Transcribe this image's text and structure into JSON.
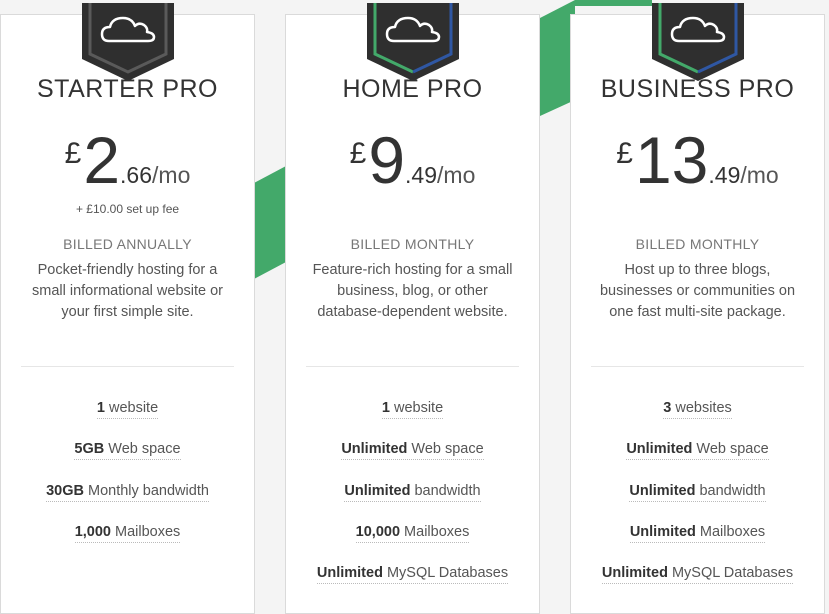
{
  "colors": {
    "accent_green": "#43a96a",
    "badge_dark": "#2f2f2f",
    "badge_blue": "#2f57a3",
    "text_dark": "#333333"
  },
  "plans": [
    {
      "name": "STARTER PRO",
      "icon": "cloud-icon",
      "currency": "£",
      "price_int": "2",
      "price_dec": ".66",
      "period": "/mo",
      "setup_fee": "+ £10.00 set up fee",
      "billing": "BILLED ANNUALLY",
      "description": "Pocket-friendly hosting for a small informational website or your first simple site.",
      "features": [
        {
          "bold": "1",
          "text": "website"
        },
        {
          "bold": "5GB",
          "text": "Web space"
        },
        {
          "bold": "30GB",
          "text": "Monthly bandwidth"
        },
        {
          "bold": "1,000",
          "text": "Mailboxes"
        }
      ]
    },
    {
      "name": "HOME PRO",
      "icon": "cloud-icon",
      "currency": "£",
      "price_int": "9",
      "price_dec": ".49",
      "period": "/mo",
      "setup_fee": "",
      "billing": "BILLED MONTHLY",
      "description": "Feature-rich hosting for a small business, blog, or other database-dependent website.",
      "features": [
        {
          "bold": "1",
          "text": "website"
        },
        {
          "bold": "Unlimited",
          "text": "Web space"
        },
        {
          "bold": "Unlimited",
          "text": "bandwidth"
        },
        {
          "bold": "10,000",
          "text": "Mailboxes"
        },
        {
          "bold": "Unlimited",
          "text": "MySQL Databases"
        }
      ]
    },
    {
      "name": "BUSINESS PRO",
      "icon": "cloud-icon",
      "currency": "£",
      "price_int": "13",
      "price_dec": ".49",
      "period": "/mo",
      "setup_fee": "",
      "billing": "BILLED MONTHLY",
      "description": "Host up to three blogs, businesses or communities on one fast multi-site package.",
      "features": [
        {
          "bold": "3",
          "text": "websites"
        },
        {
          "bold": "Unlimited",
          "text": "Web space"
        },
        {
          "bold": "Unlimited",
          "text": "bandwidth"
        },
        {
          "bold": "Unlimited",
          "text": "Mailboxes"
        },
        {
          "bold": "Unlimited",
          "text": "MySQL Databases"
        }
      ]
    }
  ]
}
